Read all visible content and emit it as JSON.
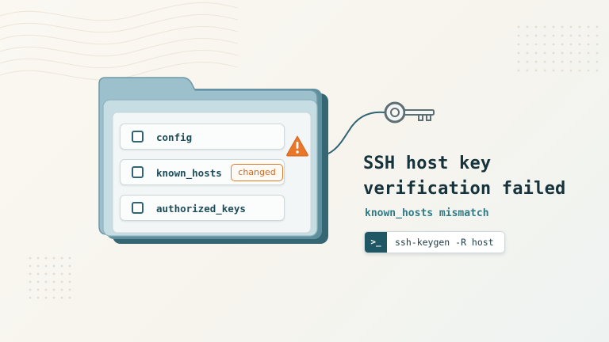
{
  "files": [
    {
      "name": "config",
      "badge": ""
    },
    {
      "name": "known_hosts",
      "badge": "changed"
    },
    {
      "name": "authorized_keys",
      "badge": ""
    }
  ],
  "heading": {
    "line1": "SSH host key",
    "line2": "verification failed"
  },
  "subtitle": "known_hosts mismatch",
  "command": {
    "prompt": ">_",
    "text": "ssh-keygen -R host"
  },
  "colors": {
    "folder": "#8fb8c6",
    "folder_dark": "#3c6b78",
    "accent_teal": "#1f5864",
    "warning_orange": "#e07b2c",
    "heading_text": "#16323a"
  },
  "icons": {
    "warning": "warning-triangle-icon",
    "key": "key-icon",
    "checkbox": "checkbox-icon",
    "terminal": "terminal-prompt-icon"
  }
}
